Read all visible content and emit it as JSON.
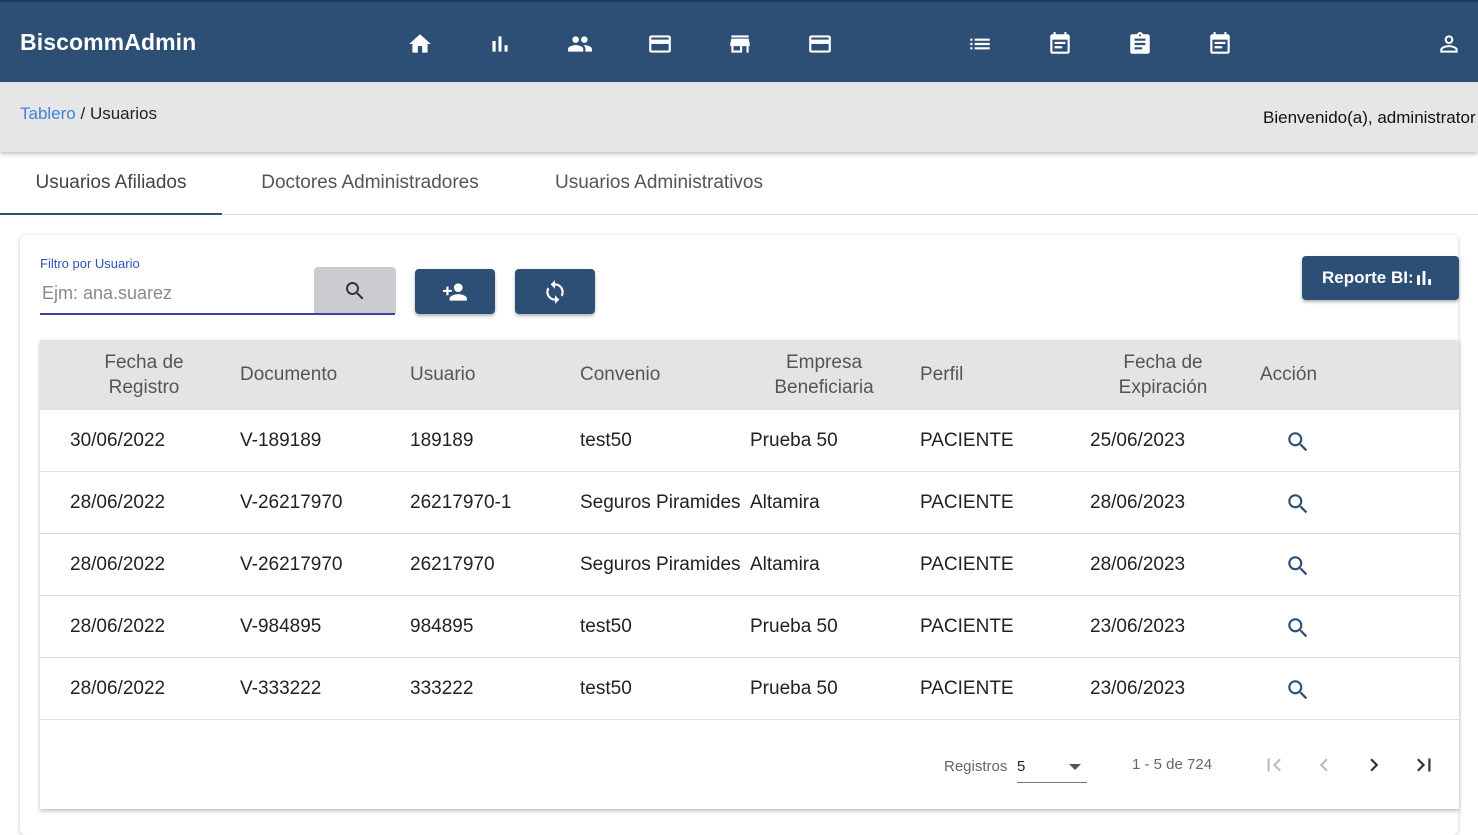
{
  "app": {
    "title": "BiscommAdmin"
  },
  "nav_icons": [
    "home-icon",
    "bar-chart-icon",
    "people-icon",
    "credit-card-icon",
    "store-icon",
    "credit-card-icon",
    "list-icon",
    "calendar-note-icon",
    "clipboard-icon",
    "calendar-icon",
    "user-account-icon"
  ],
  "breadcrumb": {
    "link": "Tablero",
    "separator": " / ",
    "current": "Usuarios"
  },
  "welcome": "Bienvenido(a), administrator",
  "tabs": [
    {
      "label": "Usuarios Afiliados",
      "active": true
    },
    {
      "label": "Doctores Administradores",
      "active": false
    },
    {
      "label": "Usuarios Administrativos",
      "active": false
    }
  ],
  "filter": {
    "label": "Filtro por Usuario",
    "placeholder": "Ejm: ana.suarez",
    "value": ""
  },
  "report_button": {
    "label": "Reporte BI:"
  },
  "table": {
    "columns": [
      "Fecha de Registro",
      "Documento",
      "Usuario",
      "Convenio",
      "Empresa Beneficiaria",
      "Perfil",
      "Fecha de Expiración",
      "Acción"
    ],
    "rows": [
      [
        "30/06/2022",
        "V-189189",
        "189189",
        "test50",
        "Prueba 50",
        "PACIENTE",
        "25/06/2023"
      ],
      [
        "28/06/2022",
        "V-26217970",
        "26217970-1",
        "Seguros Piramides",
        "Altamira",
        "PACIENTE",
        "28/06/2023"
      ],
      [
        "28/06/2022",
        "V-26217970",
        "26217970",
        "Seguros Piramides",
        "Altamira",
        "PACIENTE",
        "28/06/2023"
      ],
      [
        "28/06/2022",
        "V-984895",
        "984895",
        "test50",
        "Prueba 50",
        "PACIENTE",
        "23/06/2023"
      ],
      [
        "28/06/2022",
        "V-333222",
        "333222",
        "test50",
        "Prueba 50",
        "PACIENTE",
        "23/06/2023"
      ]
    ]
  },
  "paginator": {
    "records_label": "Registros",
    "page_size": "5",
    "range": "1 - 5 de 724"
  },
  "colors": {
    "primary": "#2d4f75",
    "link": "#3f82d6",
    "header_bg": "#e4e4e4",
    "crumb_bg": "#e6e6e6"
  }
}
